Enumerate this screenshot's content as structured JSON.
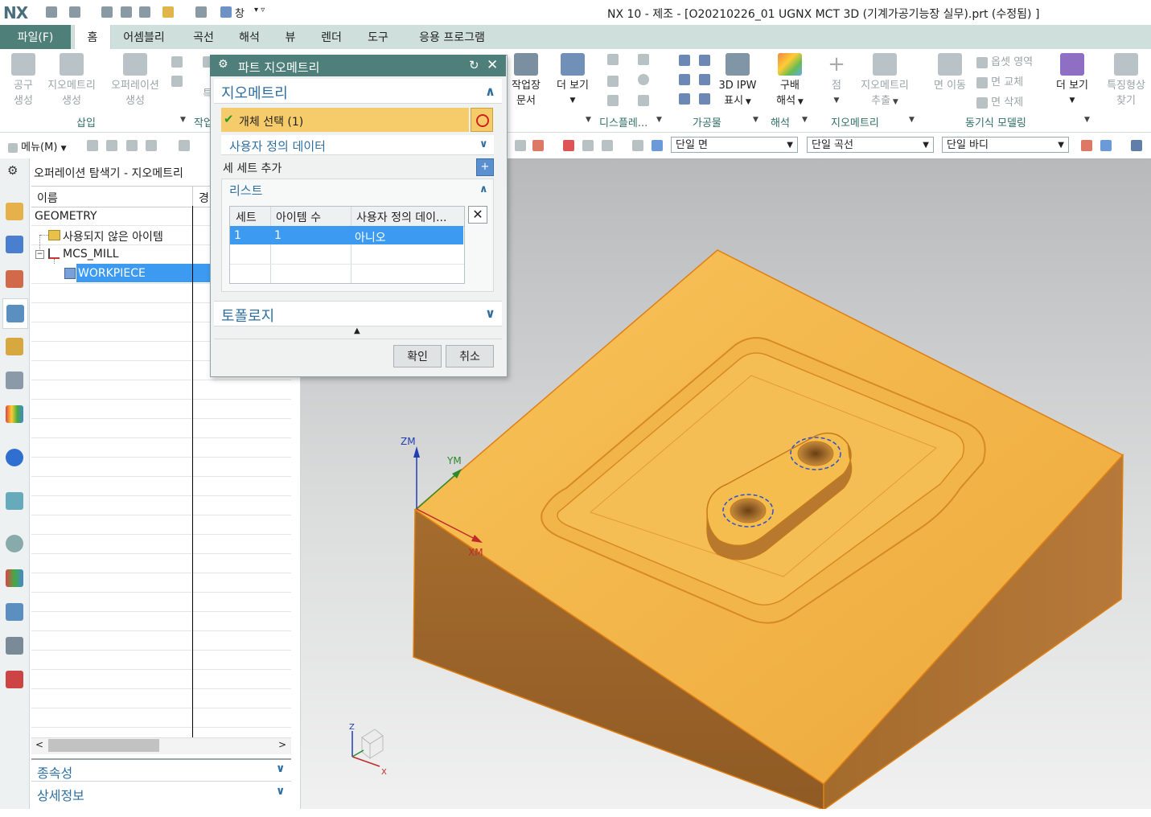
{
  "app": {
    "logo": "NX",
    "window_title": "NX 10 - 제조 - [O20210226_01 UGNX MCT 3D (기계가공기능장 실무).prt (수정됨) ]",
    "quick_window": "창"
  },
  "ribbon_tabs": [
    {
      "label": "파일(F)"
    },
    {
      "label": "홈"
    },
    {
      "label": "어셈블리"
    },
    {
      "label": "곡선"
    },
    {
      "label": "해석"
    },
    {
      "label": "뷰"
    },
    {
      "label": "렌더"
    },
    {
      "label": "도구"
    },
    {
      "label": "응용 프로그램"
    }
  ],
  "ribbon": {
    "insert": {
      "tool_create": [
        "공구",
        "생성"
      ],
      "geometry_create": [
        "지오메트리",
        "생성"
      ],
      "operation_create": [
        "오퍼레이션",
        "생성"
      ],
      "group_label": "삽입"
    },
    "partial_group_label": "작업",
    "partial_label_2": "특",
    "shop_doc": [
      "작업장",
      "문서"
    ],
    "more_view_1": [
      "더 보기"
    ],
    "display_group": "디스플레...",
    "ipw": [
      "3D IPW",
      "표시"
    ],
    "machining_group": "가공물",
    "gradient": [
      "구배",
      "해석"
    ],
    "analysis_group": "해석",
    "point": "점",
    "geometry_extract": [
      "지오메트리",
      "추출"
    ],
    "geometry_group": "지오메트리",
    "move_face": "면 이동",
    "offset_region": "옵셋 영역",
    "replace_face": "면 교체",
    "delete_face": "면 삭제",
    "more_view_2": "더 보기",
    "sync_group": "동기식 모델링",
    "feature_find": [
      "특징형상",
      "찾기"
    ]
  },
  "toolbar2": {
    "menu": "메뉴(M)",
    "filter_face": "단일 면",
    "filter_curve": "단일 곡선",
    "filter_body": "단일 바디"
  },
  "navigator": {
    "title": "오퍼레이션 탐색기 - 지오메트리",
    "col_name": "이름",
    "col_path": "경",
    "rows": [
      {
        "label": "GEOMETRY"
      },
      {
        "label": "사용되지 않은 아이템"
      },
      {
        "label": "MCS_MILL"
      },
      {
        "label": "WORKPIECE"
      }
    ],
    "panel_dependency": "종속성",
    "panel_details": "상세정보"
  },
  "dialog": {
    "title": "파트 지오메트리",
    "section_geometry": "지오메트리",
    "select_object": "개체 선택 (1)",
    "user_data": "사용자 정의 데이터",
    "add_set": "세 세트 추가",
    "list_label": "리스트",
    "table_headers": [
      "세트",
      "아이템 수",
      "사용자 정의 데이..."
    ],
    "table_row": [
      "1",
      "1",
      "아니오"
    ],
    "topology": "토폴로지",
    "ok": "확인",
    "cancel": "취소"
  },
  "viewport": {
    "axis_zm": "ZM",
    "axis_ym": "YM",
    "axis_xm": "XM",
    "triad_z": "Z",
    "triad_x": "X"
  },
  "colors": {
    "accent_teal": "#4f7f7a",
    "tab_bar": "#cfe0dc",
    "section_blue": "#2f6fa0",
    "selection_orange": "#f6cc6a",
    "row_selected": "#3c9bf0",
    "part_top": "#f2b23e",
    "part_side": "#9a6328"
  }
}
